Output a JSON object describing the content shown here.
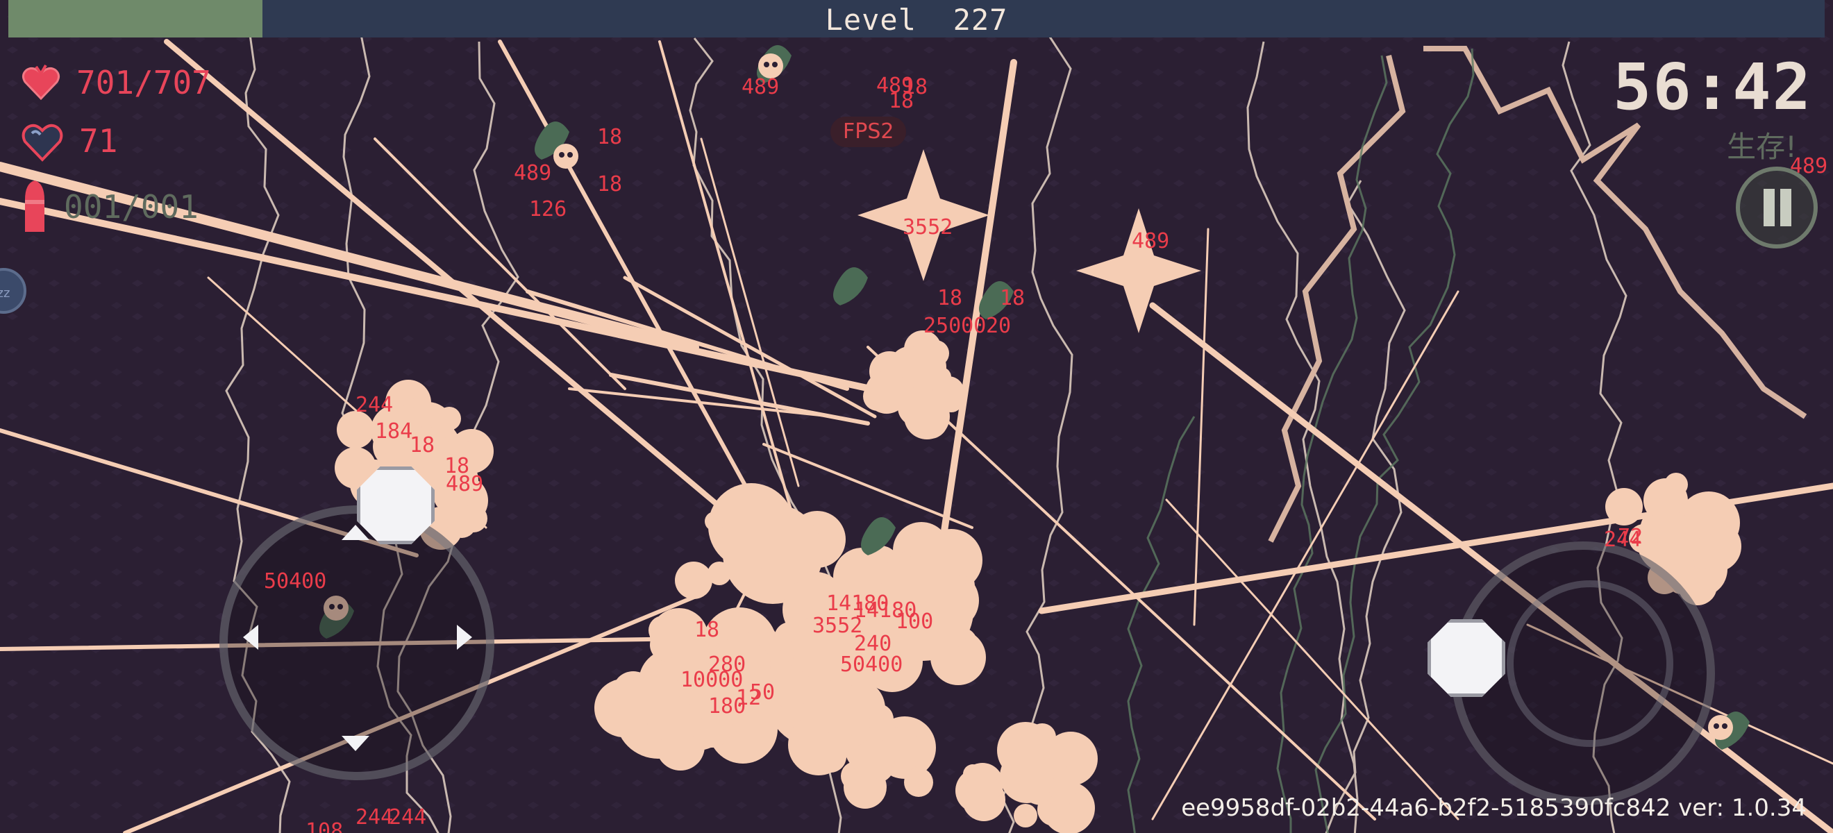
{
  "header": {
    "level_label": "Level",
    "level_value": "227",
    "xp_progress": 0.14
  },
  "hud": {
    "health": "701/707",
    "armor": "71",
    "ammo": "001/001",
    "timer": "56:42",
    "survive_label": "生存!",
    "fps_label": "FPS2",
    "zz_label": "zz"
  },
  "damage_numbers": [
    "489",
    "489",
    "18",
    "18",
    "489",
    "18",
    "18",
    "126",
    "3552",
    "489",
    "18",
    "18",
    "25000",
    "20",
    "244",
    "184",
    "18",
    "18",
    "489",
    "50400",
    "14180",
    "14180",
    "100",
    "3552",
    "240",
    "50400",
    "18",
    "244",
    "244",
    "280",
    "10000",
    "50",
    "180",
    "12",
    "72",
    "244",
    "108",
    "489"
  ],
  "build": {
    "id": "ee9958df-02b2-44a6-b2f2-5185390fc842",
    "version_label": "ver:",
    "version": "1.0.34"
  },
  "colors": {
    "background": "#2b1f33",
    "bullet": "#f5cdb4",
    "damage_text": "#ea3c4a",
    "xp_fill": "#6f8a6a",
    "xp_bar": "#2f3a52",
    "enemy": "#4b6b55"
  },
  "icons": {
    "health": "heart-icon",
    "armor": "shield-heart-icon",
    "ammo": "bullet-icon",
    "pause": "pause-icon"
  }
}
